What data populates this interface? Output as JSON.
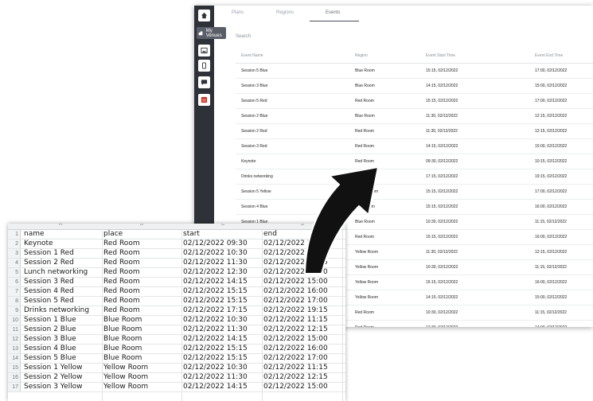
{
  "nav": {
    "tooltip_label": "My Venues"
  },
  "tabs": [
    {
      "label": "Plans"
    },
    {
      "label": "Regions"
    },
    {
      "label": "Events"
    }
  ],
  "search": {
    "label": "Search"
  },
  "events_table": {
    "headers": [
      "Event Name",
      "Region",
      "Event Start Time",
      "Event End Time"
    ],
    "rows": [
      [
        "Session 5 Blue",
        "Blue Room",
        "15:15, 02/12/2022",
        "17:00, 02/12/2022"
      ],
      [
        "Session 3 Blue",
        "Blue Room",
        "14:15, 02/12/2022",
        "15:00, 02/12/2022"
      ],
      [
        "Session 5 Red",
        "Red Room",
        "15:15, 02/12/2022",
        "17:00, 02/12/2022"
      ],
      [
        "Session 2 Blue",
        "Blue Room",
        "11:30, 02/12/2022",
        "12:15, 02/12/2022"
      ],
      [
        "Session 2 Red",
        "Red Room",
        "11:30, 02/12/2022",
        "12:15, 02/12/2022"
      ],
      [
        "Session 3 Red",
        "Red Room",
        "14:15, 02/12/2022",
        "15:00, 02/12/2022"
      ],
      [
        "Keynote",
        "Red Room",
        "09:30, 02/12/2022",
        "10:15, 02/12/2022"
      ],
      [
        "Drinks networking",
        "Red Room",
        "17:15, 02/12/2022",
        "19:15, 02/12/2022"
      ],
      [
        "Session 5 Yellow",
        "Yellow Room",
        "15:15, 02/12/2022",
        "17:00, 02/12/2022"
      ],
      [
        "Session 4 Blue",
        "Blue Room",
        "15:15, 02/12/2022",
        "16:00, 02/12/2022"
      ],
      [
        "Session 1 Blue",
        "Blue Room",
        "10:30, 02/12/2022",
        "11:15, 02/12/2022"
      ],
      [
        "",
        "Red Room",
        "15:15, 02/12/2022",
        "16:00, 02/12/2022"
      ],
      [
        "",
        "Yellow Room",
        "11:30, 02/12/2022",
        "12:15, 02/12/2022"
      ],
      [
        "",
        "Yellow Room",
        "10:30, 02/12/2022",
        "11:15, 02/12/2022"
      ],
      [
        "",
        "Yellow Room",
        "15:15, 02/12/2022",
        "16:00, 02/12/2022"
      ],
      [
        "",
        "Yellow Room",
        "14:15, 02/12/2022",
        "15:00, 02/12/2022"
      ],
      [
        "",
        "Red Room",
        "10:30, 02/12/2022",
        "11:15, 02/12/2022"
      ],
      [
        "",
        "Red Room",
        "12:30, 02/12/2022",
        "14:00, 02/12/2022"
      ]
    ]
  },
  "spreadsheet": {
    "column_letters": [
      "A",
      "B",
      "C",
      "D"
    ],
    "row_numbers": [
      "1",
      "2",
      "3",
      "4",
      "5",
      "6",
      "7",
      "8",
      "9",
      "10",
      "11",
      "12",
      "13",
      "14",
      "15",
      "16",
      "17"
    ],
    "rows": [
      [
        "name",
        "place",
        "start",
        "end"
      ],
      [
        "Keynote",
        "Red Room",
        "02/12/2022 09:30",
        "02/12/2022 10:15"
      ],
      [
        "Session 1 Red",
        "Red Room",
        "02/12/2022 10:30",
        "02/12/2022 11:15"
      ],
      [
        "Session 2 Red",
        "Red Room",
        "02/12/2022 11:30",
        "02/12/2022 12:15"
      ],
      [
        "Lunch networking",
        "Red Room",
        "02/12/2022 12:30",
        "02/12/2022 14:00"
      ],
      [
        "Session 3 Red",
        "Red Room",
        "02/12/2022 14:15",
        "02/12/2022 15:00"
      ],
      [
        "Session 4 Red",
        "Red Room",
        "02/12/2022 15:15",
        "02/12/2022 16:00"
      ],
      [
        "Session 5 Red",
        "Red Room",
        "02/12/2022 15:15",
        "02/12/2022 17:00"
      ],
      [
        "Drinks networking",
        "Red Room",
        "02/12/2022 17:15",
        "02/12/2022 19:15"
      ],
      [
        "Session 1 Blue",
        "Blue Room",
        "02/12/2022 10:30",
        "02/12/2022 11:15"
      ],
      [
        "Session 2 Blue",
        "Blue Room",
        "02/12/2022 11:30",
        "02/12/2022 12:15"
      ],
      [
        "Session 3 Blue",
        "Blue Room",
        "02/12/2022 14:15",
        "02/12/2022 15:00"
      ],
      [
        "Session 4 Blue",
        "Blue Room",
        "02/12/2022 15:15",
        "02/12/2022 16:00"
      ],
      [
        "Session 5 Blue",
        "Blue Room",
        "02/12/2022 15:15",
        "02/12/2022 17:00"
      ],
      [
        "Session 1 Yellow",
        "Yellow Room",
        "02/12/2022 10:30",
        "02/12/2022 11:15"
      ],
      [
        "Session 2 Yellow",
        "Yellow Room",
        "02/12/2022 11:30",
        "02/12/2022 12:15"
      ],
      [
        "Session 3 Yellow",
        "Yellow Room",
        "02/12/2022 14:15",
        "02/12/2022 15:00"
      ]
    ]
  },
  "colors": {
    "rail": "#2e3137",
    "accent_red": "#c0392b"
  }
}
